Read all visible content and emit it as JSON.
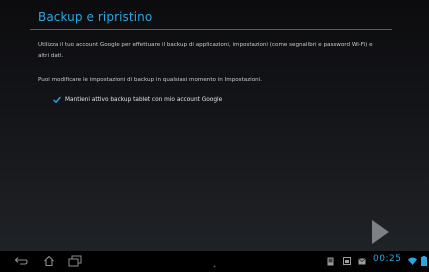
{
  "header": {
    "title": "Backup e ripristino"
  },
  "content": {
    "paragraph1": "Utilizza il tuo account Google per effettuare il backup di applicazioni, impostazioni (come segnalibri e password Wi-Fi) e altri dati.",
    "paragraph2": "Puoi modificare le impostazioni di backup in qualsiasi momento in Impostazioni.",
    "checkbox_label": "Mantieni attivo backup tablet con mio account Google",
    "checkbox_checked": true
  },
  "navigation": {
    "next_icon": "play-arrow-icon"
  },
  "system_bar": {
    "back_icon": "back-icon",
    "home_icon": "home-icon",
    "recents_icon": "recents-icon",
    "status_icons": [
      "gallery-icon",
      "screenshot-icon",
      "email-icon",
      "wifi-icon",
      "battery-icon"
    ],
    "time": "00:25"
  },
  "colors": {
    "accent": "#2da5e0"
  }
}
